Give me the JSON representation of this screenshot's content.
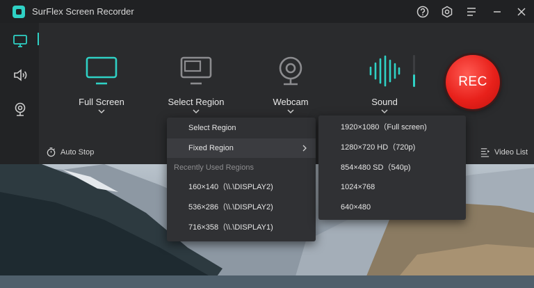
{
  "window": {
    "title": "SurFlex Screen Recorder"
  },
  "titlebar_icons": [
    "help-icon",
    "settings-icon",
    "menu-icon",
    "minimize-icon",
    "close-icon"
  ],
  "sidebar": {
    "items": [
      "monitor-icon",
      "speaker-icon",
      "webcam-icon"
    ],
    "active_index": 0
  },
  "modes": {
    "full_screen": "Full Screen",
    "select_region": "Select Region",
    "webcam": "Webcam",
    "sound": "Sound"
  },
  "record_button": "REC",
  "bottom_bar": {
    "auto_stop": "Auto Stop",
    "video_list": "Video List"
  },
  "region_menu": {
    "select_region": "Select Region",
    "fixed_region": "Fixed Region",
    "recent_header": "Recently Used Regions",
    "recent": [
      "160×140（\\\\.\\DISPLAY2)",
      "536×286（\\\\.\\DISPLAY2)",
      "716×358（\\\\.\\DISPLAY1)"
    ]
  },
  "fixed_region_submenu": {
    "options": [
      "1920×1080（Full screen)",
      "1280×720 HD（720p)",
      "854×480 SD（540p)",
      "1024×768",
      "640×480"
    ]
  },
  "colors": {
    "accent": "#2fd1c5",
    "record": "#e8211b",
    "window_bg": "#262729",
    "menu_bg": "#303134"
  }
}
